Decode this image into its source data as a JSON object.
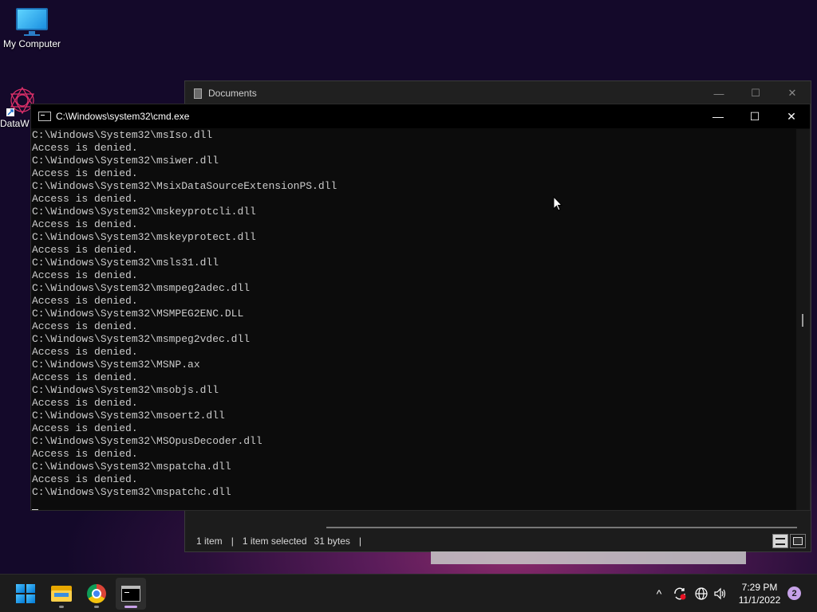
{
  "desktop": {
    "icons": [
      {
        "label": "My Computer"
      },
      {
        "label": "DataW"
      }
    ]
  },
  "explorer": {
    "title": "Documents",
    "status": {
      "items": "1 item",
      "selected": "1 item selected",
      "size": "31 bytes",
      "sep": "|"
    }
  },
  "cmd": {
    "title": "C:\\Windows\\system32\\cmd.exe",
    "lines": [
      "C:\\Windows\\System32\\msIso.dll",
      "Access is denied.",
      "C:\\Windows\\System32\\msiwer.dll",
      "Access is denied.",
      "C:\\Windows\\System32\\MsixDataSourceExtensionPS.dll",
      "Access is denied.",
      "C:\\Windows\\System32\\mskeyprotcli.dll",
      "Access is denied.",
      "C:\\Windows\\System32\\mskeyprotect.dll",
      "Access is denied.",
      "C:\\Windows\\System32\\msls31.dll",
      "Access is denied.",
      "C:\\Windows\\System32\\msmpeg2adec.dll",
      "Access is denied.",
      "C:\\Windows\\System32\\MSMPEG2ENC.DLL",
      "Access is denied.",
      "C:\\Windows\\System32\\msmpeg2vdec.dll",
      "Access is denied.",
      "C:\\Windows\\System32\\MSNP.ax",
      "Access is denied.",
      "C:\\Windows\\System32\\msobjs.dll",
      "Access is denied.",
      "C:\\Windows\\System32\\msoert2.dll",
      "Access is denied.",
      "C:\\Windows\\System32\\MSOpusDecoder.dll",
      "Access is denied.",
      "C:\\Windows\\System32\\mspatcha.dll",
      "Access is denied.",
      "C:\\Windows\\System32\\mspatchc.dll"
    ]
  },
  "window_controls": {
    "minimize": "—",
    "maximize": "☐",
    "close": "✕"
  },
  "taskbar": {
    "apps": [
      {
        "name": "start",
        "icon": "windows-logo-icon"
      },
      {
        "name": "file-explorer",
        "icon": "folder-icon"
      },
      {
        "name": "chrome",
        "icon": "chrome-icon"
      },
      {
        "name": "terminal",
        "icon": "terminal-icon"
      }
    ],
    "tray": {
      "chevron": "^",
      "time": "7:29 PM",
      "date": "11/1/2022",
      "notifications": "2"
    }
  }
}
